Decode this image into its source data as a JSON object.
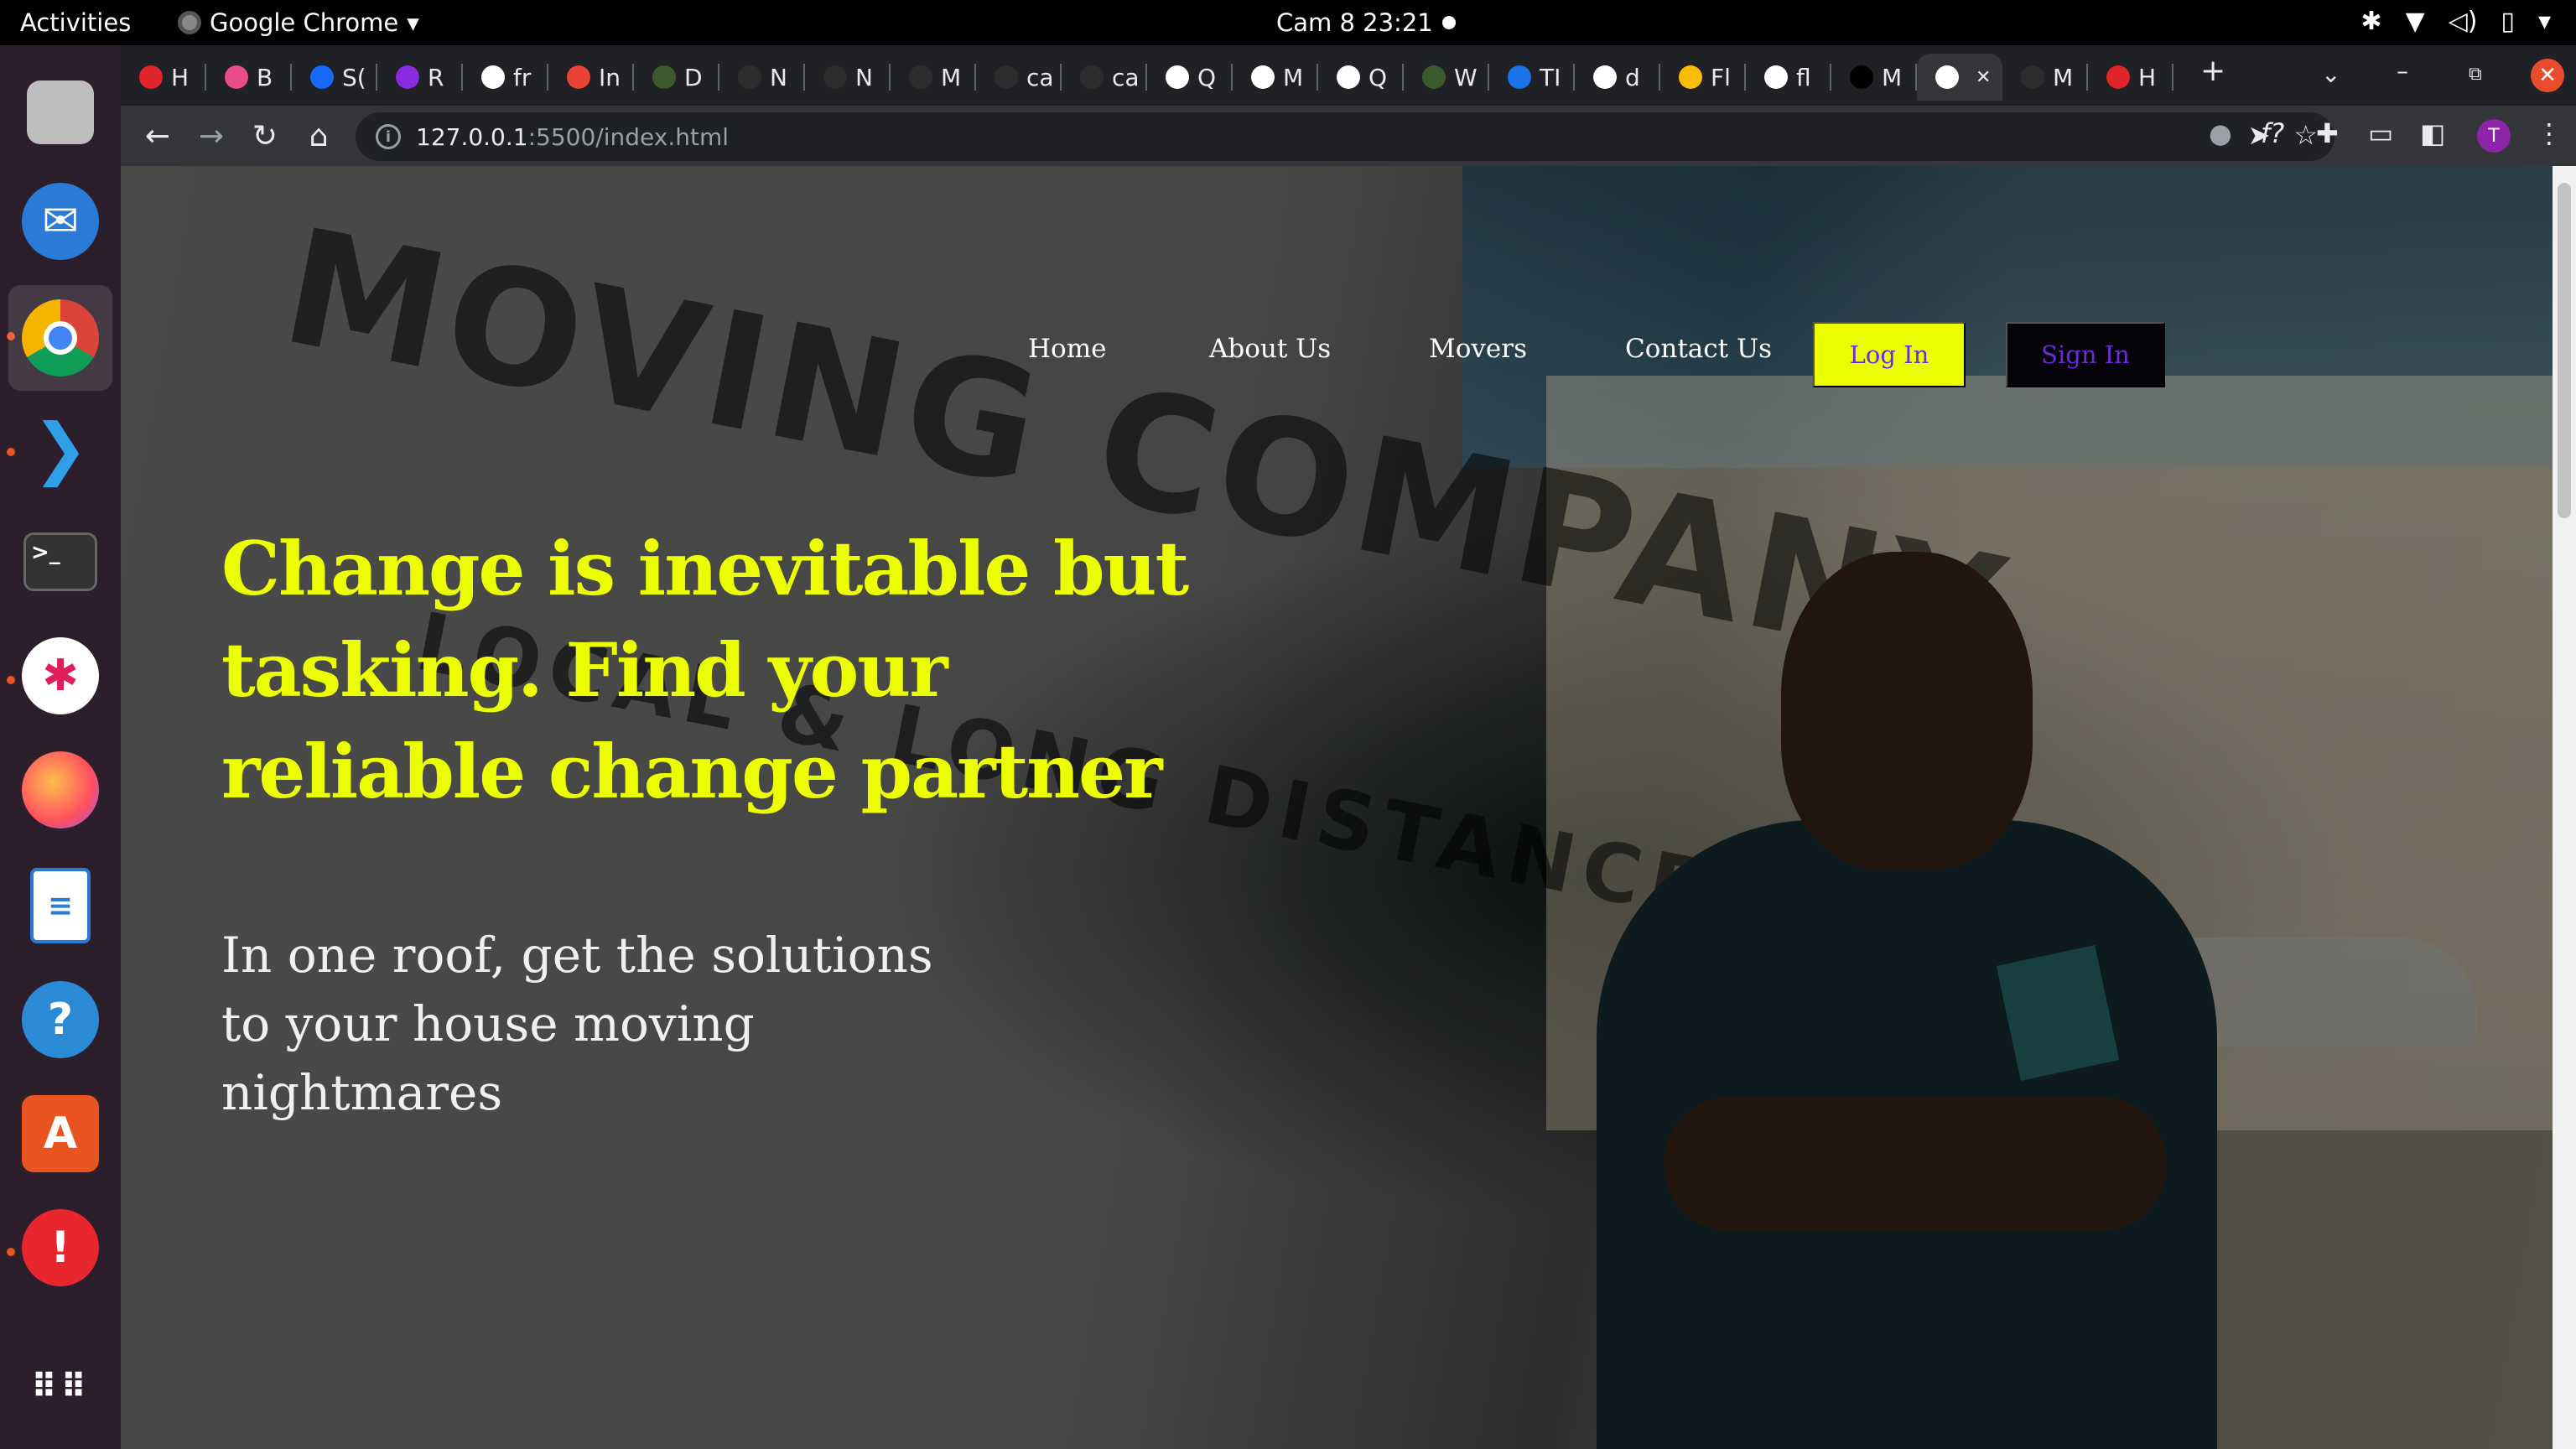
{
  "system": {
    "activities": "Activities",
    "app_name": "Google Chrome",
    "clock": "Cam 8  23:21"
  },
  "browser": {
    "tabs": [
      {
        "label": "H",
        "color": "#e0242a"
      },
      {
        "label": "B",
        "color": "#ea4c89"
      },
      {
        "label": "S(",
        "color": "#1769ff"
      },
      {
        "label": "R",
        "color": "#8a2be2"
      },
      {
        "label": "fr",
        "color": "#ffffff"
      },
      {
        "label": "In",
        "color": "#ea4335"
      },
      {
        "label": "D",
        "color": "#3d5a2c"
      },
      {
        "label": "N",
        "color": "#2c2c2c"
      },
      {
        "label": "N",
        "color": "#2c2c2c"
      },
      {
        "label": "M",
        "color": "#2c2c2c"
      },
      {
        "label": "ca",
        "color": "#2c2c2c"
      },
      {
        "label": "ca",
        "color": "#2c2c2c"
      },
      {
        "label": "Q",
        "color": "#ffffff"
      },
      {
        "label": "M",
        "color": "#ffffff"
      },
      {
        "label": "Q",
        "color": "#ffffff"
      },
      {
        "label": "W",
        "color": "#3d5a2c"
      },
      {
        "label": "TI",
        "color": "#1a73e8"
      },
      {
        "label": "d",
        "color": "#ffffff"
      },
      {
        "label": "Fl",
        "color": "#fbbc04"
      },
      {
        "label": "fl",
        "color": "#ffffff"
      },
      {
        "label": "M",
        "color": "#000000"
      },
      {
        "label": "",
        "color": "#ffffff"
      },
      {
        "label": "M",
        "color": "#2c2c2c"
      },
      {
        "label": "H",
        "color": "#e0242a"
      }
    ],
    "url_host": "127.0.0.1",
    "url_rest": ":5500/index.html",
    "profile_initial": "T"
  },
  "site": {
    "nav": {
      "home": "Home",
      "about": "About Us",
      "movers": "Movers",
      "contact": "Contact Us",
      "login": "Log In",
      "signin": "Sign In"
    },
    "hero": {
      "title": "Change is inevitable but tasking. Find your reliable change partner",
      "subtitle": "In one roof, get the solutions to your house moving nightmares"
    },
    "background_text": {
      "line1": "MOVING COMPANY",
      "line2": "LOCAL & LONG DISTANCE"
    }
  },
  "colors": {
    "accent": "#ecff00",
    "button_text": "#6a2bdb"
  }
}
